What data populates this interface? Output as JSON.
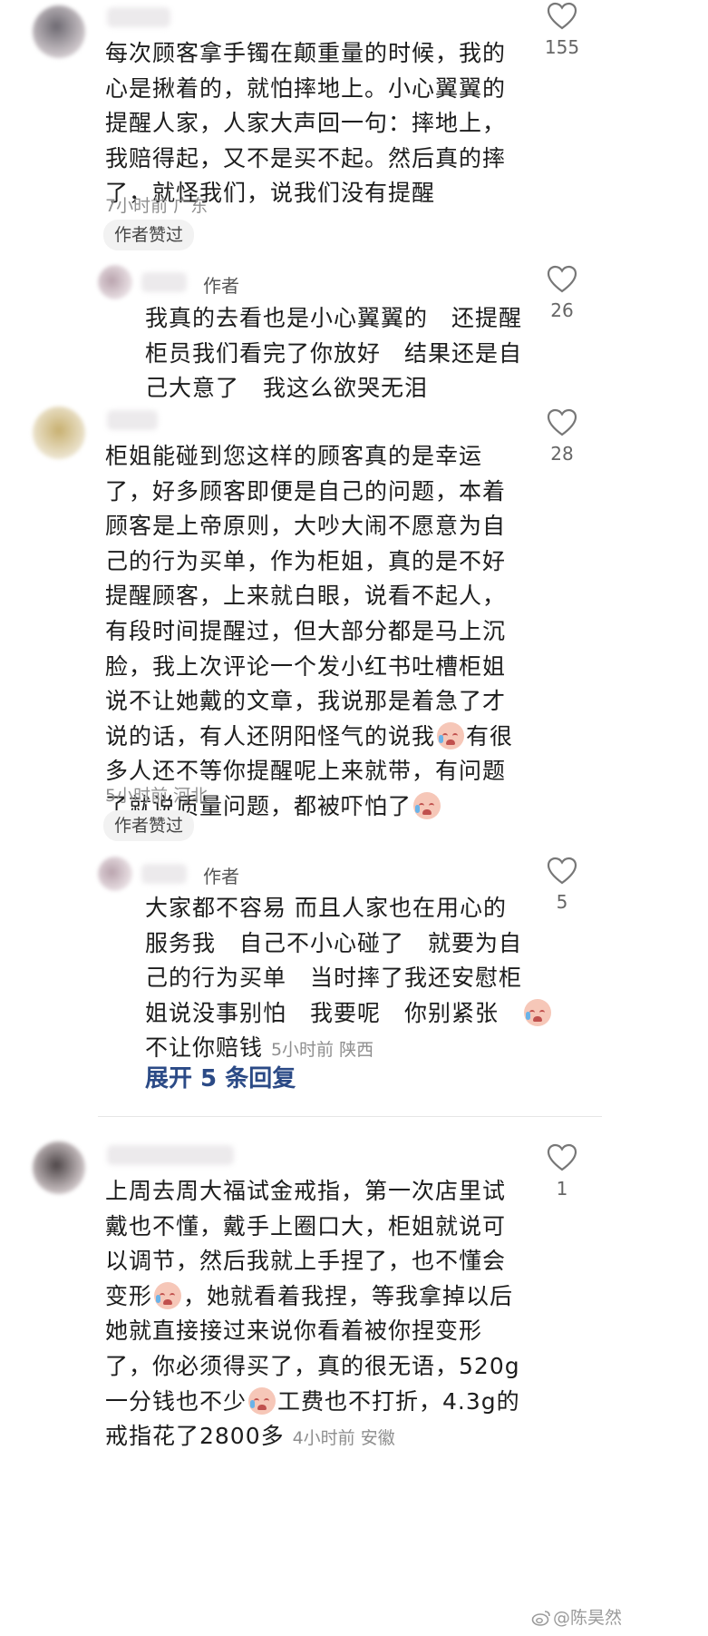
{
  "comments": [
    {
      "lines": [
        "每次顾客拿手镯在颠重量的时候，我的",
        "心是揪着的，就怕摔地上。小心翼翼的",
        "提醒人家，人家大声回一句：摔地上，",
        "我赔得起，又不是买不起。然后真的摔",
        "了，就怪我们，说我们没有提醒"
      ],
      "meta": "7小时前 广东",
      "badge": "作者赞过",
      "likes": "155"
    },
    {
      "lines_a": [
        "柜姐能碰到您这样的顾客真的是幸运",
        "了，好多顾客即便是自己的问题，本着",
        "顾客是上帝原则，大吵大闹不愿意为自",
        "己的行为买单，作为柜姐，真的是不好",
        "提醒顾客，上来就白眼，说看不起人，",
        "有段时间提醒过，但大部分都是马上沉",
        "脸，我上次评论一个发小红书吐槽柜姐",
        "说不让她戴的文章，我说那是着急了才"
      ],
      "line9_pre": "说的话，有人还阴阳怪气的说我",
      "line9_post": "有很",
      "line10": "多人还不等你提醒呢上来就带，有问题",
      "line11_pre": "了就说质量问题，都被吓怕了",
      "meta": "5小时前 河北",
      "badge": "作者赞过",
      "likes": "28"
    },
    {
      "line1": "上周去周大福试金戒指，第一次店里试",
      "line2": "戴也不懂，戴手上圈口大，柜姐就说可",
      "line3": "以调节，然后我就上手捏了，也不懂会",
      "line4_pre": "变形",
      "line4_post": "，她就看着我捏，等我拿掉以后",
      "line5": "她就直接接过来说你看着被你捏变形",
      "line6": "了，你必须得买了，真的很无语，520g",
      "line7_pre": "一分钱也不少",
      "line7_post": "工费也不打折，4.3g的",
      "line8": "戒指花了2800多",
      "meta": "4小时前 安徽",
      "likes": "1"
    }
  ],
  "replies": [
    {
      "author_tag": "作者",
      "lines": [
        "我真的去看也是小心翼翼的　还提醒",
        "柜员我们看完了你放好　结果还是自",
        "己大意了　我这么欲哭无泪"
      ],
      "likes": "26"
    },
    {
      "author_tag": "作者",
      "lines": [
        "大家都不容易 而且人家也在用心的",
        "服务我　自己不小心碰了　就要为自",
        "己的行为买单　当时摔了我还安慰柜"
      ],
      "line4_pre": "姐说没事别怕　我要呢　你别紧张　",
      "line5": "不让你赔钱",
      "meta": "5小时前 陕西",
      "likes": "5"
    }
  ],
  "expand_label": "展开 5 条回复",
  "watermark": "@陈昊然",
  "icons": [
    "heart-outline-icon",
    "crying-face-emoji",
    "weibo-logo-icon"
  ]
}
